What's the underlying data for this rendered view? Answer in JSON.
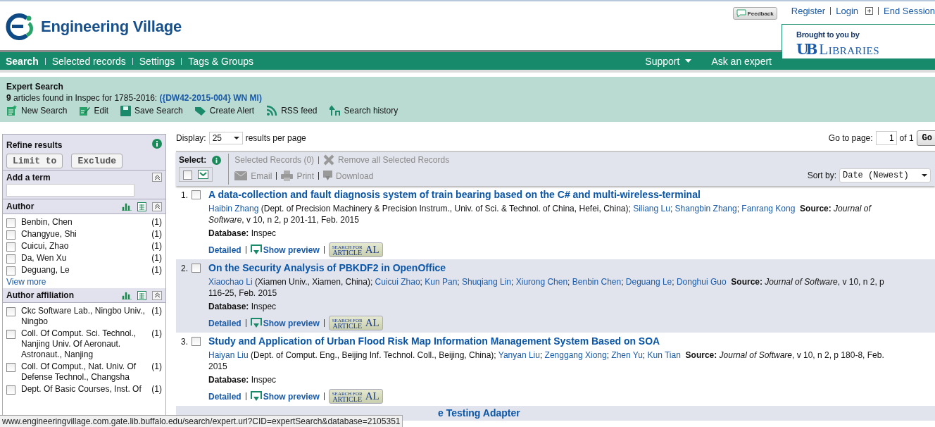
{
  "header": {
    "logo": "Engineering Village",
    "feedback": "Feedback",
    "user_links": [
      {
        "label": "Register",
        "kind": "link"
      },
      {
        "label": "Login",
        "kind": "expand"
      },
      {
        "label": "End Session",
        "kind": "link"
      }
    ],
    "sponsor": {
      "caption": "Brought to you by",
      "mark": "UB",
      "name": "LIBRARIES"
    }
  },
  "nav": {
    "left": [
      {
        "label": "Search",
        "selected": true
      },
      {
        "label": "Selected records",
        "selected": false
      },
      {
        "label": "Settings",
        "selected": false
      },
      {
        "label": "Tags & Groups",
        "selected": false
      }
    ],
    "right": [
      {
        "label": "Support",
        "kind": "menu"
      },
      {
        "label": "Ask an expert",
        "kind": "link"
      }
    ]
  },
  "search_summary": {
    "title": "Expert Search",
    "result_text": "**9** articles found in Inspec for 1785-2016:",
    "query": "({DW42-2015-004} WN MI)",
    "tools": [
      {
        "label": "New Search",
        "kind": "new"
      },
      {
        "label": "Edit",
        "kind": "edit"
      },
      {
        "label": "Save Search",
        "kind": "save"
      },
      {
        "label": "Create Alert",
        "kind": "alert"
      },
      {
        "label": "RSS feed",
        "kind": "rss"
      },
      {
        "label": "Search history",
        "kind": "history"
      }
    ]
  },
  "sidebar": {
    "title": "Refine results",
    "buttons": [
      "Limit to",
      "Exclude"
    ],
    "add_term": "Add a term",
    "facets": [
      {
        "title": "Author",
        "more": "View more",
        "items": [
          {
            "label": "Benbin, Chen",
            "count": "(1)",
            "checked": false
          },
          {
            "label": "Changyue, Shi",
            "count": "(1)",
            "checked": false
          },
          {
            "label": "Cuicui, Zhao",
            "count": "(1)",
            "checked": false
          },
          {
            "label": "Da, Wen Xu",
            "count": "(1)",
            "checked": false
          },
          {
            "label": "Deguang, Le",
            "count": "(1)",
            "checked": false
          }
        ]
      },
      {
        "title": "Author affiliation",
        "items": [
          {
            "label": "Ckc Software Lab., Ningbo Univ., Ningbo",
            "count": "(1)",
            "checked": false
          },
          {
            "label": "Coll. Of Comput. Sci. Technol., Nanjing Univ. Of Aeronaut. Astronaut., Nanjing",
            "count": "(1)",
            "checked": false
          },
          {
            "label": "Coll. Of Comput., Nat. Univ. Of Defense Technol., Changsha",
            "count": "(1)",
            "checked": false
          },
          {
            "label": "Dept. Of Basic Courses, Inst. Of",
            "count": "(1)",
            "checked": false
          }
        ]
      }
    ]
  },
  "results": {
    "display": {
      "label": "Display:",
      "value": "25",
      "suffix": "results per page"
    },
    "pager": {
      "label": "Go to page:",
      "value": "1",
      "total": "of 1",
      "button": "Go"
    },
    "select_label": "Select:",
    "select_all_checked": false,
    "actions": [
      {
        "label": "Selected Records (0)",
        "kind": "text",
        "disabled": true
      },
      {
        "label": "Remove all Selected Records",
        "kind": "remove",
        "disabled": true
      }
    ],
    "exports": [
      {
        "label": "Email",
        "kind": "email",
        "disabled": true
      },
      {
        "label": "Print",
        "kind": "print",
        "disabled": true
      },
      {
        "label": "Download",
        "kind": "download",
        "disabled": true
      }
    ],
    "sort": {
      "label": "Sort by:",
      "value": "Date (Newest)"
    },
    "records": [
      {
        "kind": "full",
        "number": "1.",
        "checked": false,
        "title": "A data-collection and fault diagnosis system of train bearing based on the C# and multi-wireless-terminal",
        "authors": [
          {
            "name": "Haibin Zhang",
            "after": " (Dept. of Precision Machinery & Precision Instrum., Univ. of Sci. & Technol. of China, Hefei, China); "
          },
          {
            "name": "Siliang Lu",
            "after": "; "
          },
          {
            "name": "Shangbin Zhang",
            "after": "; "
          },
          {
            "name": "Fanrang Kong"
          }
        ],
        "source": "**Source:** *Journal of Software*, v 10, n 2, p 201-11, Feb. 2015",
        "database": "**Database:** Inspec",
        "links": [
          "Detailed",
          "Show preview"
        ],
        "badge": {
          "top": "SEARCH FOR",
          "bottom": "ARTICLE",
          "mark": "AL"
        }
      },
      {
        "kind": "full",
        "number": "2.",
        "checked": false,
        "title": "On the Security Analysis of PBKDF2 in OpenOffice",
        "authors": [
          {
            "name": "Xiaochao Li",
            "after": " (Xiamen Univ., Xiamen, China); "
          },
          {
            "name": "Cuicui Zhao",
            "after": "; "
          },
          {
            "name": "Kun Pan",
            "after": "; "
          },
          {
            "name": "Shuqiang Lin",
            "after": "; "
          },
          {
            "name": "Xiurong Chen",
            "after": "; "
          },
          {
            "name": "Benbin Chen",
            "after": "; "
          },
          {
            "name": "Deguang Le",
            "after": "; "
          },
          {
            "name": "Donghui Guo"
          }
        ],
        "source": "**Source:** *Journal of Software*, v 10, n 2, p 116-25, Feb. 2015",
        "database": "**Database:** Inspec",
        "links": [
          "Detailed",
          "Show preview"
        ],
        "badge": {
          "top": "SEARCH FOR",
          "bottom": "ARTICLE",
          "mark": "AL"
        }
      },
      {
        "kind": "full",
        "number": "3.",
        "checked": false,
        "title": "Study and Application of Urban Flood Risk Map Information Management System Based on SOA",
        "authors": [
          {
            "name": "Haiyan Liu",
            "after": " (Dept. of Comput. Eng., Beijing Inf. Technol. Coll., Beijing, China); "
          },
          {
            "name": "Yanyan Liu",
            "after": "; "
          },
          {
            "name": "Zenggang Xiong",
            "after": "; "
          },
          {
            "name": "Zhen Yu",
            "after": "; "
          },
          {
            "name": "Kun Tian"
          }
        ],
        "source": "**Source:** *Journal of Software*, v 10, n 2, p 180-8, Feb. 2015",
        "database": "**Database:** Inspec",
        "links": [
          "Detailed",
          "Show preview"
        ],
        "badge": {
          "top": "SEARCH FOR",
          "bottom": "ARTICLE",
          "mark": "AL"
        }
      },
      {
        "kind": "partial",
        "title": "e Testing Adapter"
      }
    ]
  },
  "status_bar": {
    "url": "www.engineeringvillage.com.gate.lib.buffalo.edu/search/expert.url?CID=expertSearch&database=2105351"
  }
}
